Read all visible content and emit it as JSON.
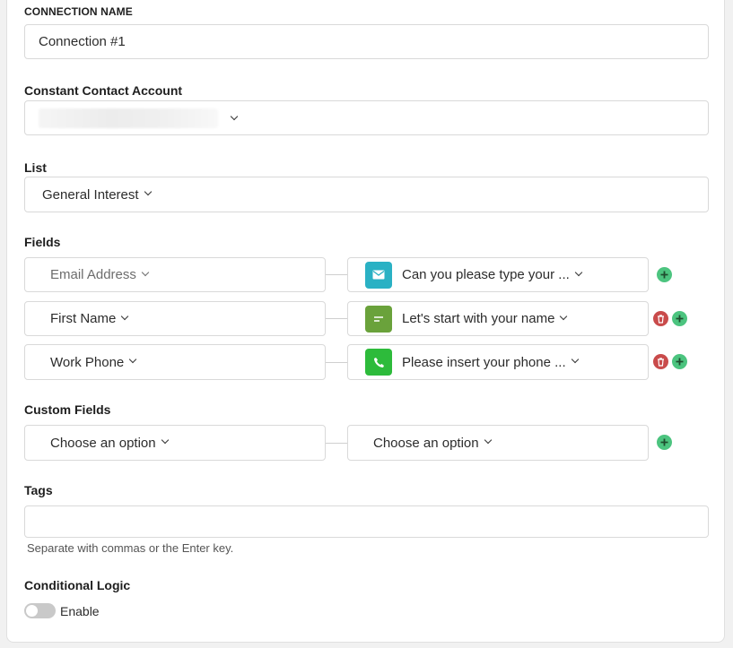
{
  "connection_name": {
    "label": "CONNECTION NAME",
    "value": "Connection #1"
  },
  "account": {
    "label": "Constant Contact Account",
    "value": ""
  },
  "list": {
    "label": "List",
    "selected": "General Interest"
  },
  "fields": {
    "label": "Fields",
    "rows": [
      {
        "field": "Email Address",
        "question": "Can you please type your ...",
        "icon": "envelope-icon",
        "icon_color": "#2ab1c4"
      },
      {
        "field": "First Name",
        "question": "Let's start with your name",
        "icon": "short-text-icon",
        "icon_color": "#6aa23b"
      },
      {
        "field": "Work Phone",
        "question": "Please insert your phone ...",
        "icon": "phone-icon",
        "icon_color": "#2dbb3b"
      }
    ]
  },
  "custom_fields": {
    "label": "Custom Fields",
    "left": "Choose an option",
    "right": "Choose an option"
  },
  "tags": {
    "label": "Tags",
    "value": "",
    "help": "Separate with commas or the Enter key."
  },
  "conditional_logic": {
    "label": "Conditional Logic",
    "toggle_label": "Enable",
    "enabled": false
  },
  "colors": {
    "add": "#4cc47f",
    "delete": "#c94b4b"
  }
}
